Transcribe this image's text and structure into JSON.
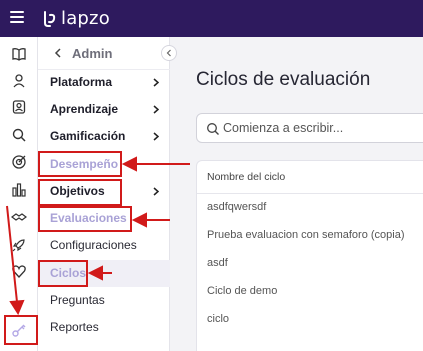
{
  "header": {
    "logo_text": "lapzo",
    "menu_icon": "hamburger-icon",
    "background": "#2e1a5e"
  },
  "rail": {
    "icons": [
      "book-icon",
      "user-icon",
      "users-icon",
      "search-icon",
      "target-icon",
      "bar-chart-icon",
      "handshake-icon",
      "rocket-icon",
      "heart-icon",
      "key-icon"
    ],
    "selected": "key-icon"
  },
  "submenu": {
    "back_label": "Admin",
    "items": [
      {
        "label": "Plataforma",
        "chevron": true
      },
      {
        "label": "Aprendizaje",
        "chevron": true
      },
      {
        "label": "Gamificación",
        "chevron": true
      },
      {
        "label": "Desempeño",
        "chevron": false
      },
      {
        "label": "Objetivos",
        "chevron": true
      },
      {
        "label": "Evaluaciones",
        "chevron": false
      },
      {
        "label": "Configuraciones",
        "chevron": false
      },
      {
        "label": "Ciclos",
        "chevron": false
      },
      {
        "label": "Preguntas",
        "chevron": false
      },
      {
        "label": "Reportes",
        "chevron": false
      }
    ]
  },
  "main": {
    "title": "Ciclos de evaluación",
    "search_placeholder": "Comienza a escribir...",
    "table_header": "Nombre del ciclo",
    "rows": [
      "asdfqwersdf",
      "Prueba evaluacion con semaforo (copia)",
      "asdf",
      "Ciclo de demo",
      "ciclo"
    ]
  },
  "colors": {
    "accent": "#a9a2d6",
    "annotation": "#d11a1a"
  }
}
